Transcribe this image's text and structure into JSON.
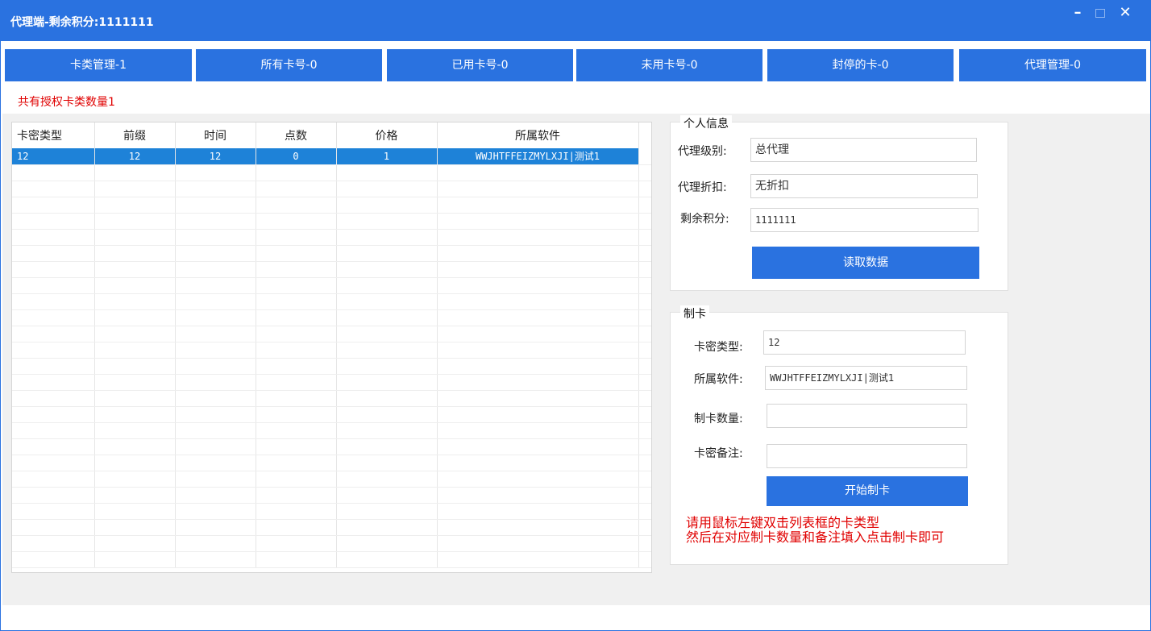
{
  "window": {
    "title": "代理端-剩余积分:1111111"
  },
  "tabs": [
    {
      "label": "卡类管理-1"
    },
    {
      "label": "所有卡号-0"
    },
    {
      "label": "已用卡号-0"
    },
    {
      "label": "未用卡号-0"
    },
    {
      "label": "封停的卡-0"
    },
    {
      "label": "代理管理-0"
    }
  ],
  "summary": "共有授权卡类数量1",
  "grid": {
    "columns": [
      "卡密类型",
      "前缀",
      "时间",
      "点数",
      "价格",
      "所属软件"
    ],
    "rows": [
      [
        "12",
        "12",
        "12",
        "0",
        "1",
        "WWJHTFFEIZMYLXJI|测试1"
      ]
    ]
  },
  "personal": {
    "legend": "个人信息",
    "level_label": "代理级别:",
    "level_value": "总代理",
    "discount_label": "代理折扣:",
    "discount_value": "无折扣",
    "points_label": "剩余积分:",
    "points_value": "1111111",
    "read_button": "读取数据"
  },
  "make": {
    "legend": "制卡",
    "type_label": "卡密类型:",
    "type_value": "12",
    "software_label": "所属软件:",
    "software_value": "WWJHTFFEIZMYLXJI|测试1",
    "count_label": "制卡数量:",
    "count_value": "",
    "note_label": "卡密备注:",
    "note_value": "",
    "start_button": "开始制卡",
    "hint_line1": "请用鼠标左键双击列表框的卡类型",
    "hint_line2": "然后在对应制卡数量和备注填入点击制卡即可"
  }
}
